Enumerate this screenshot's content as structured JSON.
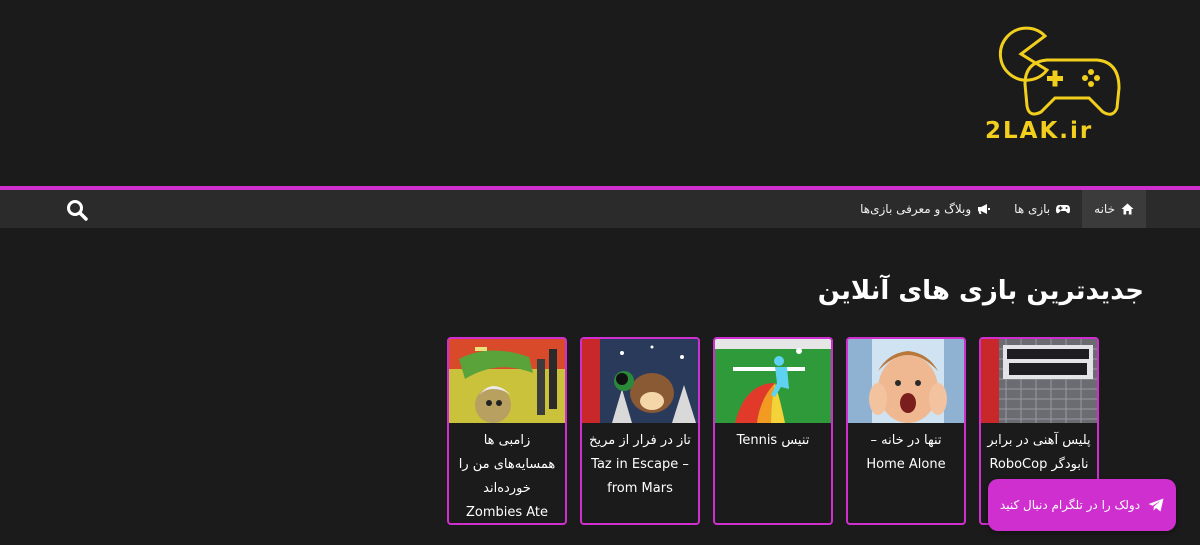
{
  "brand": {
    "logo_text": "2LAK.ir",
    "accent_color": "#d02fd0",
    "logo_color": "#f2cf1d"
  },
  "nav": {
    "items": [
      {
        "label": "خانه",
        "icon": "home-icon",
        "active": true
      },
      {
        "label": "بازی ها",
        "icon": "gamepad-icon",
        "active": false
      },
      {
        "label": "وبلاگ و معرفی بازی‌ها",
        "icon": "megaphone-icon",
        "active": false
      }
    ],
    "search_icon": "search-icon"
  },
  "section": {
    "title": "جدیدترین بازی های آنلاین"
  },
  "games": [
    {
      "title": "پلیس آهنی در برابر نابودگر RoboCop"
    },
    {
      "title": "تنها در خانه – Home Alone"
    },
    {
      "title": "تنیس Tennis"
    },
    {
      "title": "تاز در فرار از مریخ – Taz in Escape from Mars"
    },
    {
      "title": "زامبی ها همسایه‌های من را خورده‌اند Zombies Ate My Neighbors"
    }
  ],
  "telegram": {
    "label": "دولک را در تلگرام دنبال کنید",
    "icon": "telegram-icon"
  }
}
